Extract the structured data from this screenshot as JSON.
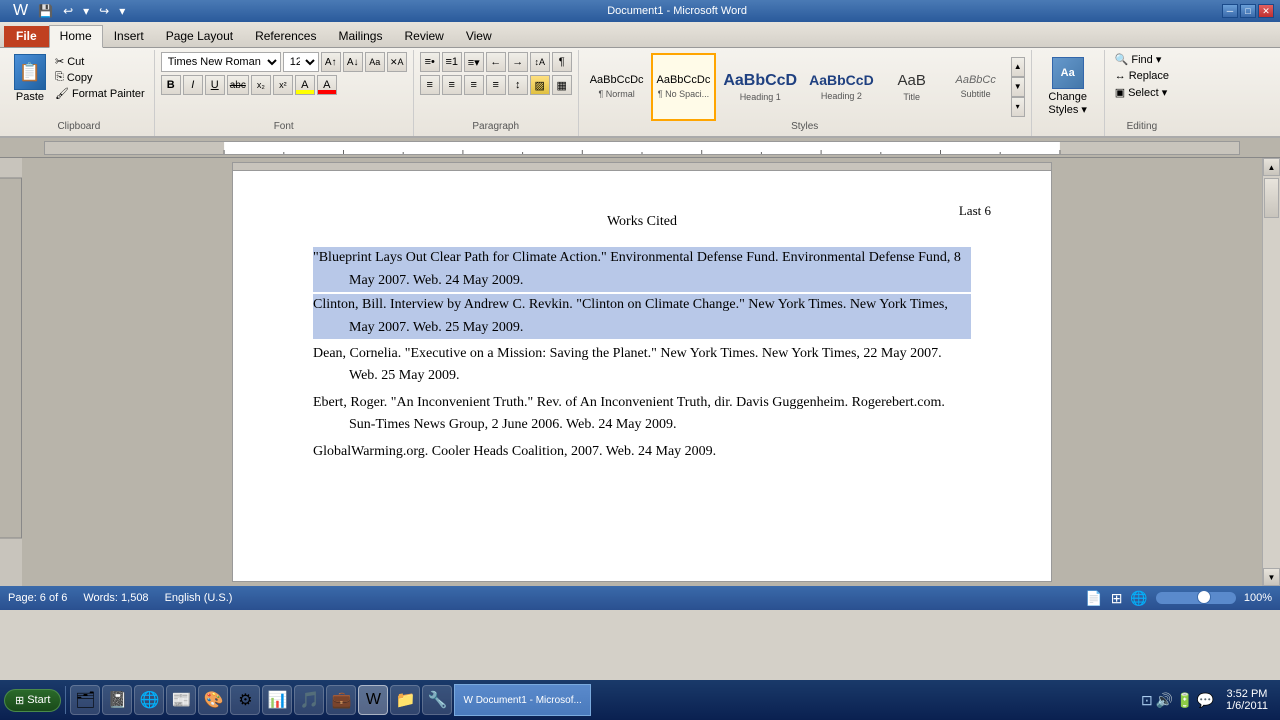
{
  "titlebar": {
    "title": "Document1 - Microsoft Word",
    "minimize": "─",
    "restore": "□",
    "close": "✕"
  },
  "quickaccess": {
    "save": "💾",
    "undo": "↩",
    "redo": "↪",
    "customize": "▾"
  },
  "tabs": [
    {
      "id": "file",
      "label": "File"
    },
    {
      "id": "home",
      "label": "Home",
      "active": true
    },
    {
      "id": "insert",
      "label": "Insert"
    },
    {
      "id": "page-layout",
      "label": "Page Layout"
    },
    {
      "id": "references",
      "label": "References"
    },
    {
      "id": "mailings",
      "label": "Mailings"
    },
    {
      "id": "review",
      "label": "Review"
    },
    {
      "id": "view",
      "label": "View"
    }
  ],
  "clipboard": {
    "label": "Clipboard",
    "paste_label": "Paste",
    "cut_label": "Cut",
    "copy_label": "Copy",
    "format_painter_label": "Format Painter"
  },
  "font": {
    "label": "Font",
    "font_name": "Times New Roman",
    "font_size": "12",
    "bold": "B",
    "italic": "I",
    "underline": "U",
    "strikethrough": "abc",
    "superscript": "x²",
    "subscript": "x₂",
    "text_highlight": "A",
    "font_color": "A",
    "grow": "A↑",
    "shrink": "A↓",
    "change_case": "Aa",
    "clear_format": "✕"
  },
  "paragraph": {
    "label": "Paragraph",
    "bullets": "≡",
    "numbering": "≡",
    "multilevel": "≡",
    "increase_indent": "→",
    "decrease_indent": "←",
    "sort": "↕",
    "show_formatting": "¶",
    "align_left": "≡",
    "align_center": "≡",
    "align_right": "≡",
    "justify": "≡",
    "line_spacing": "↕",
    "shading": "▨",
    "borders": "▦"
  },
  "styles": {
    "label": "Styles",
    "items": [
      {
        "id": "normal",
        "preview": "AaBbCcDc",
        "label": "¶ Normal"
      },
      {
        "id": "no-spacing",
        "preview": "AaBbCcDc",
        "label": "¶ No Spaci...",
        "selected": true
      },
      {
        "id": "heading1",
        "preview": "AaBbCcD",
        "label": "Heading 1"
      },
      {
        "id": "heading2",
        "preview": "AaBbCcD",
        "label": "Heading 2"
      },
      {
        "id": "title",
        "preview": "AaB",
        "label": "Title"
      },
      {
        "id": "subtitle",
        "preview": "AaBbCc",
        "label": "Subtitle"
      }
    ],
    "scroll_up": "▲",
    "scroll_down": "▼",
    "more": "▾"
  },
  "change_styles": {
    "label": "Change\nStyles ▾"
  },
  "editing": {
    "label": "Editing",
    "find_label": "Find ▾",
    "replace_label": "Replace",
    "select_label": "Select ▾"
  },
  "document": {
    "page_number": "Last 6",
    "title": "Works Cited",
    "citations": [
      {
        "id": 1,
        "text": "\"Blueprint Lays Out Clear Path for Climate Action.\" Environmental Defense Fund. Environmental Defense Fund, 8 May 2007. Web. 24 May 2009.",
        "selected": true
      },
      {
        "id": 2,
        "text": "Clinton, Bill. Interview by Andrew C. Revkin. \"Clinton on Climate Change.\" New York Times. New York Times, May 2007. Web. 25 May 2009.",
        "selected": true
      },
      {
        "id": 3,
        "text": "Dean, Cornelia. \"Executive on a Mission: Saving the Planet.\" New York Times. New York Times, 22 May 2007. Web. 25 May 2009.",
        "selected": false
      },
      {
        "id": 4,
        "text": "Ebert, Roger. \"An Inconvenient Truth.\" Rev. of An Inconvenient Truth, dir. Davis Guggenheim. Rogerebert.com. Sun-Times News Group, 2 June 2006. Web. 24 May 2009.",
        "selected": false
      },
      {
        "id": 5,
        "text": "GlobalWarming.org. Cooler Heads Coalition, 2007. Web. 24 May 2009.",
        "selected": false
      }
    ]
  },
  "status_bar": {
    "page": "Page: 6 of 6",
    "words": "Words: 1,508",
    "language": "English (U.S.)",
    "zoom": "100%"
  },
  "taskbar": {
    "time": "3:52 PM",
    "date": "1/6/2011",
    "word_label": "Document1 - Microsof..."
  }
}
